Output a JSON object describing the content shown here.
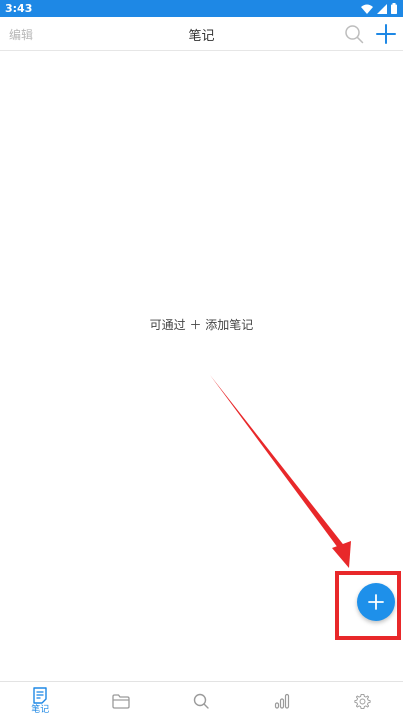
{
  "status_bar": {
    "time": "3:43",
    "icons": [
      "wifi-icon",
      "signal-icon",
      "battery-icon"
    ]
  },
  "top_bar": {
    "edit_label": "编辑",
    "title": "笔记",
    "icons": [
      "search-icon",
      "plus-icon"
    ]
  },
  "main": {
    "empty_hint": "可通过 ＋ 添加笔记"
  },
  "fab": {
    "icon": "plus-icon"
  },
  "bottom_nav": {
    "items": [
      {
        "icon": "notes-icon",
        "label": "笔记",
        "active": true
      },
      {
        "icon": "folder-icon",
        "label": "",
        "active": false
      },
      {
        "icon": "search-icon",
        "label": "",
        "active": false
      },
      {
        "icon": "stats-icon",
        "label": "",
        "active": false
      },
      {
        "icon": "gear-icon",
        "label": "",
        "active": false
      }
    ]
  },
  "colors": {
    "accent": "#1e88e5",
    "annotation": "#e8282a",
    "inactive_icon": "#9a9a9a"
  }
}
